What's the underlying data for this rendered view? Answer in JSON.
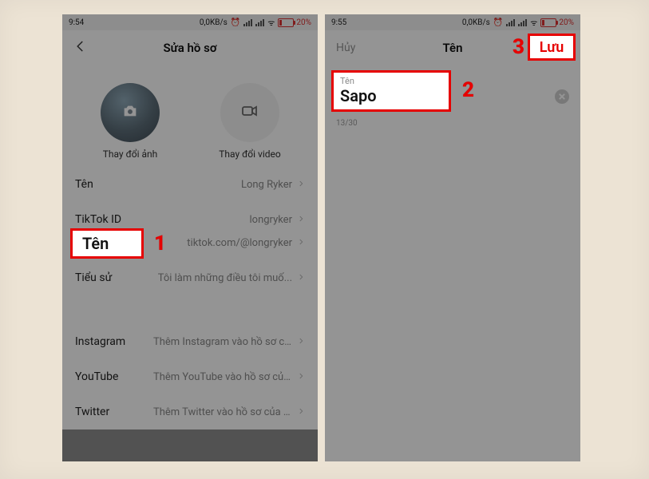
{
  "colors": {
    "accent_red": "#e60000",
    "battery_red": "#d33"
  },
  "status_bar": {
    "time_left": "9:54",
    "time_right": "9:55",
    "net": "0,0KB/s",
    "battery_pct": "20%",
    "alarm_icon": "alarm-icon",
    "signal_icon": "signal-icon",
    "battery_icon": "battery-icon"
  },
  "left_screen": {
    "nav": {
      "back_icon": "back-arrow-icon",
      "title": "Sửa hồ sơ"
    },
    "media": {
      "photo_label": "Thay đổi ảnh",
      "video_label": "Thay đổi video",
      "camera_icon": "camera-icon",
      "video_icon": "video-icon"
    },
    "rows": {
      "name": {
        "label": "Tên",
        "value": "Long Ryker"
      },
      "id": {
        "label": "TikTok ID",
        "value": "longryker"
      },
      "link": {
        "value": "tiktok.com/@longryker"
      },
      "bio": {
        "label": "Tiểu sử",
        "value": "Tôi làm những điều tôi muố..."
      },
      "instagram": {
        "label": "Instagram",
        "value": "Thêm Instagram vào hồ sơ của bạn"
      },
      "youtube": {
        "label": "YouTube",
        "value": "Thêm YouTube vào hồ sơ của bạn"
      },
      "twitter": {
        "label": "Twitter",
        "value": "Thêm Twitter vào hồ sơ của bạn"
      }
    }
  },
  "right_screen": {
    "nav": {
      "cancel": "Hủy",
      "title": "Tên",
      "save": "Lưu"
    },
    "field": {
      "label": "Tên",
      "value": "Sapo",
      "counter": "13/30",
      "clear_icon": "close-icon"
    }
  },
  "callouts": {
    "one": {
      "text": "Tên",
      "num": "1"
    },
    "two": {
      "label": "Tên",
      "value": "Sapo",
      "num": "2"
    },
    "three": {
      "text": "Lưu",
      "num": "3"
    }
  }
}
